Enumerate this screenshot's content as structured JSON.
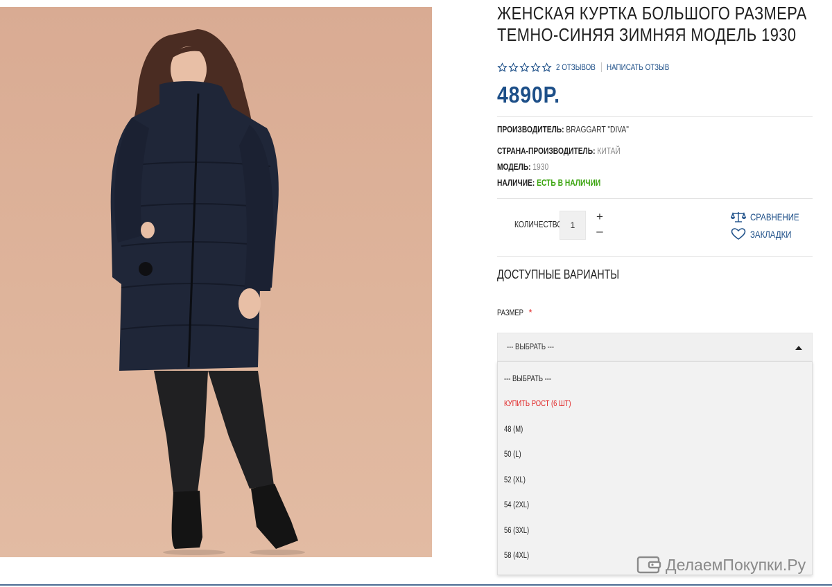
{
  "product": {
    "title_line1": "ЖЕНСКАЯ КУРТКА БОЛЬШОГО РАЗМЕРА",
    "title_line2": "ТЕМНО-СИНЯЯ ЗИМНЯЯ МОДЕЛЬ 1930",
    "rating": 0,
    "rating_max": 5,
    "reviews_link": "2 ОТЗЫВОВ",
    "write_review_link": "НАПИСАТЬ ОТЗЫВ",
    "price": "4890Р."
  },
  "specs": {
    "manufacturer_label": "ПРОИЗВОДИТЕЛЬ:",
    "manufacturer_value": "BRAGGART \"DIVA\"",
    "country_label": "СТРАНА-ПРОИЗВОДИТЕЛЬ:",
    "country_value": "КИТАЙ",
    "model_label": "МОДЕЛЬ:",
    "model_value": "1930",
    "availability_label": "НАЛИЧИЕ:",
    "availability_value": "ЕСТЬ В НАЛИЧИИ"
  },
  "quantity": {
    "label": "КОЛИЧЕСТВО",
    "value": "1",
    "plus": "+",
    "minus": "–"
  },
  "actions": {
    "compare": "СРАВНЕНИЕ",
    "bookmarks": "ЗАКЛАДКИ",
    "compare_icon": "scales-icon",
    "bookmarks_icon": "heart-icon"
  },
  "variants": {
    "title": "ДОСТУПНЫЕ ВАРИАНТЫ",
    "size_label": "РАЗМЕР",
    "required_mark": "*",
    "selected": "--- ВЫБРАТЬ ---",
    "options": [
      "--- ВЫБРАТЬ ---",
      "КУПИТЬ РОСТ (6 ШТ)",
      "48 (M)",
      "50 (L)",
      "52 (XL)",
      "54 (2XL)",
      "56 (3XL)",
      "58 (4XL)"
    ]
  },
  "watermark": "ДелаемПокупки.Ру",
  "colors": {
    "accent": "#1d4f88",
    "in_stock": "#3aa40e",
    "required": "#e02020",
    "photo_background": "#dcb097"
  }
}
